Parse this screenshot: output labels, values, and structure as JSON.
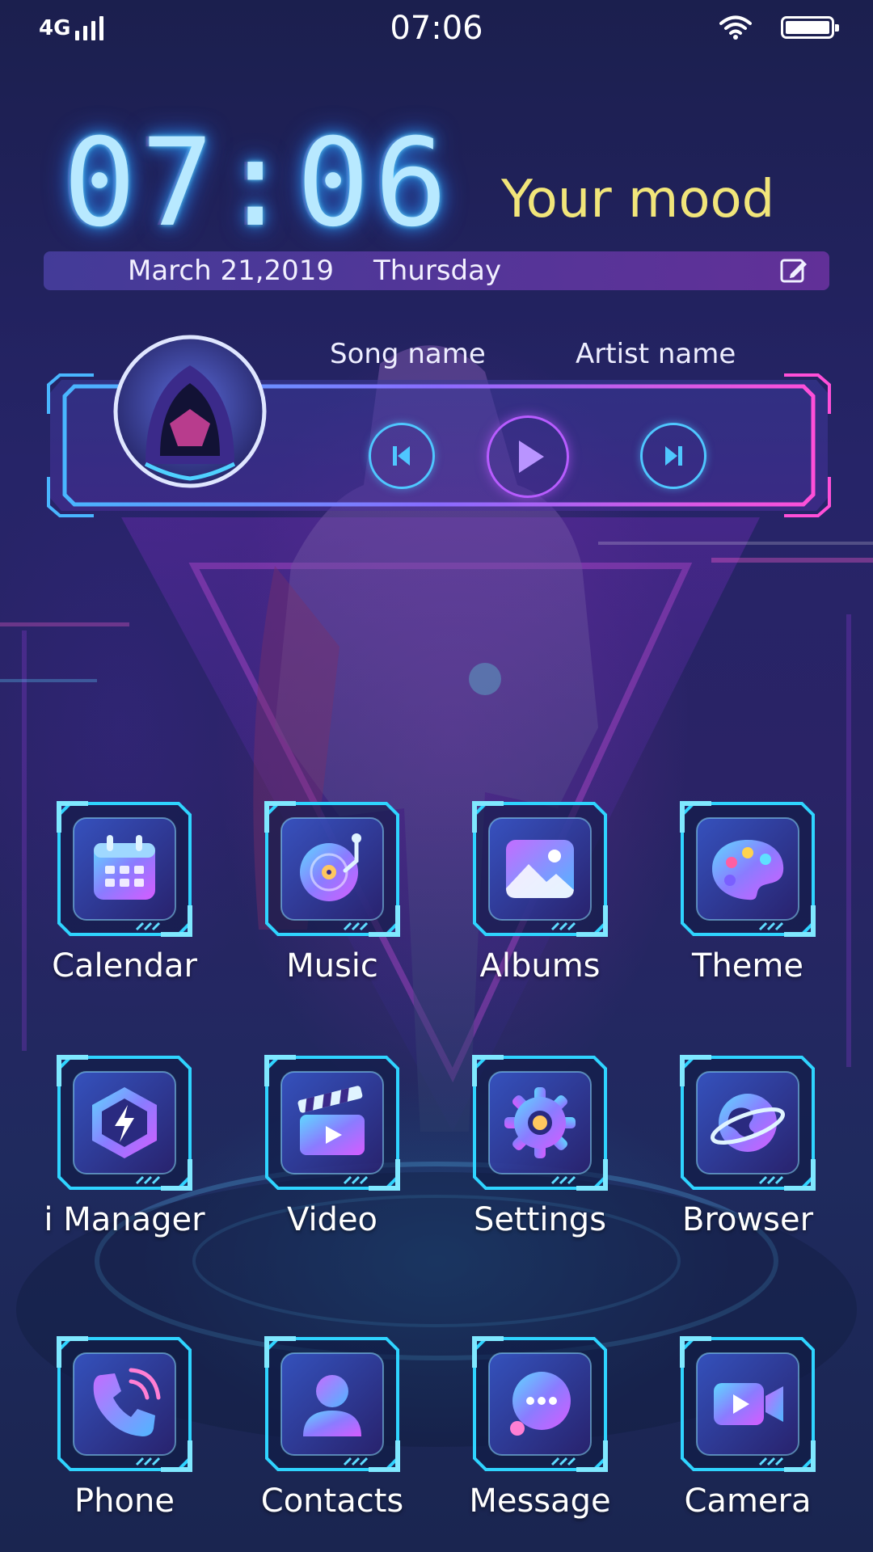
{
  "status_bar": {
    "network": "4G",
    "time": "07:06",
    "signal_bars": 4,
    "battery_level": 1.0,
    "icons": [
      "signal-icon",
      "wifi-icon",
      "battery-icon"
    ]
  },
  "clock_widget": {
    "time": "07:06",
    "mood": "Your mood",
    "date": "March 21,2019",
    "day": "Thursday",
    "edit_icon": "edit-icon"
  },
  "music_widget": {
    "song": "Song name",
    "artist": "Artist name",
    "controls": [
      "previous-icon",
      "play-icon",
      "next-icon"
    ]
  },
  "apps": [
    {
      "label": "Calendar",
      "icon": "calendar-icon"
    },
    {
      "label": "Music",
      "icon": "music-disc-icon"
    },
    {
      "label": "Albums",
      "icon": "albums-image-icon"
    },
    {
      "label": "Theme",
      "icon": "palette-icon"
    },
    {
      "label": "i Manager",
      "icon": "lightning-shield-icon"
    },
    {
      "label": "Video",
      "icon": "clapper-icon"
    },
    {
      "label": "Settings",
      "icon": "gear-icon"
    },
    {
      "label": "Browser",
      "icon": "planet-icon"
    },
    {
      "label": "Phone",
      "icon": "phone-icon"
    },
    {
      "label": "Contacts",
      "icon": "contact-person-icon"
    },
    {
      "label": "Message",
      "icon": "chat-bubble-icon"
    },
    {
      "label": "Camera",
      "icon": "video-camera-icon"
    }
  ],
  "colors": {
    "accent_cyan": "#4fc7ff",
    "accent_purple": "#b85cff",
    "mood_yellow": "#f1e57a",
    "clock_glow": "#5fd0ff"
  }
}
